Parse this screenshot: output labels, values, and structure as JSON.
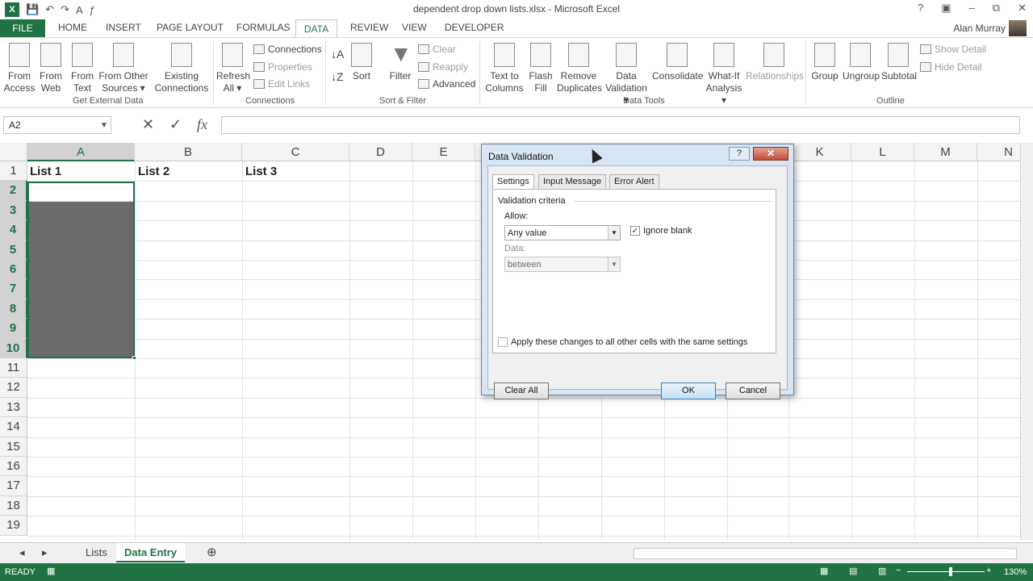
{
  "window": {
    "title": "dependent drop down lists.xlsx - Microsoft Excel",
    "user": "Alan Murray",
    "min": "–",
    "restore": "⧉",
    "close": "✕"
  },
  "tabs": [
    "FILE",
    "HOME",
    "INSERT",
    "PAGE LAYOUT",
    "FORMULAS",
    "DATA",
    "REVIEW",
    "VIEW",
    "DEVELOPER"
  ],
  "ribbon": {
    "get_external": {
      "access": "From Access",
      "web": "From Web",
      "text": "From Text",
      "other": "From Other Sources ▾",
      "existing": "Existing Connections",
      "label": "Get External Data"
    },
    "connections": {
      "refresh": "Refresh All ▾",
      "connections": "Connections",
      "properties": "Properties",
      "edit_links": "Edit Links",
      "label": "Connections"
    },
    "sort_filter": {
      "sort": "Sort",
      "filter": "Filter",
      "clear": "Clear",
      "reapply": "Reapply",
      "advanced": "Advanced",
      "label": "Sort & Filter"
    },
    "data_tools": {
      "text_to_columns": "Text to Columns",
      "flash_fill": "Flash Fill",
      "remove_duplicates": "Remove Duplicates",
      "data_validation": "Data Validation ▾",
      "consolidate": "Consolidate",
      "what_if": "What-If Analysis ▾",
      "relationships": "Relationships",
      "label": "Data Tools"
    },
    "outline": {
      "group": "Group",
      "ungroup": "Ungroup",
      "subtotal": "Subtotal",
      "show_detail": "Show Detail",
      "hide_detail": "Hide Detail",
      "label": "Outline"
    }
  },
  "formula_bar": {
    "name_box": "A2",
    "fx": "fx",
    "cancel": "✕",
    "enter": "✓"
  },
  "grid": {
    "columns": [
      "A",
      "B",
      "C",
      "D",
      "E",
      "K",
      "L",
      "M",
      "N"
    ],
    "rows": [
      "1",
      "2",
      "3",
      "4",
      "5",
      "6",
      "7",
      "8",
      "9",
      "10",
      "11",
      "12",
      "13",
      "14",
      "15",
      "16",
      "17",
      "18",
      "19"
    ],
    "cells": {
      "A1": "List 1",
      "B1": "List 2",
      "C1": "List 3"
    }
  },
  "sheets": {
    "lists": "Lists",
    "entry": "Data Entry",
    "add": "⊕"
  },
  "status": {
    "mode": "READY",
    "zoom": "130%"
  },
  "dialog": {
    "title": "Data Validation",
    "help": "?",
    "close": "✕",
    "tabs": {
      "settings": "Settings",
      "input": "Input Message",
      "error": "Error Alert"
    },
    "criteria": "Validation criteria",
    "allow_label": "Allow:",
    "allow_value": "Any value",
    "ignore_blank": "Ignore blank",
    "data_label": "Data:",
    "data_value": "between",
    "apply_all": "Apply these changes to all other cells with the same settings",
    "clear_all": "Clear All",
    "ok": "OK",
    "cancel": "Cancel"
  }
}
